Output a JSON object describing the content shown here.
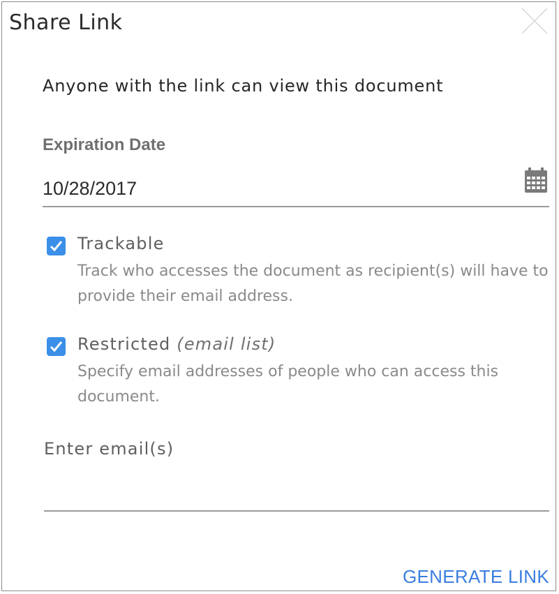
{
  "dialog": {
    "title": "Share Link",
    "subtitle": "Anyone with the link can view this document"
  },
  "expiration": {
    "label": "Expiration Date",
    "value": "10/28/2017",
    "icon": "calendar-icon"
  },
  "options": {
    "trackable": {
      "checked": true,
      "label": "Trackable",
      "description": "Track who accesses the document as recipient(s) will have to provide their email address."
    },
    "restricted": {
      "checked": true,
      "label": "Restricted",
      "label_note": "(email list)",
      "description": "Specify email addresses of people who can access this document."
    }
  },
  "email": {
    "label": "Enter email(s)",
    "value": ""
  },
  "actions": {
    "generate_label": "GENERATE LINK"
  },
  "colors": {
    "accent": "#3b8fe8",
    "link": "#3a7ee0"
  }
}
